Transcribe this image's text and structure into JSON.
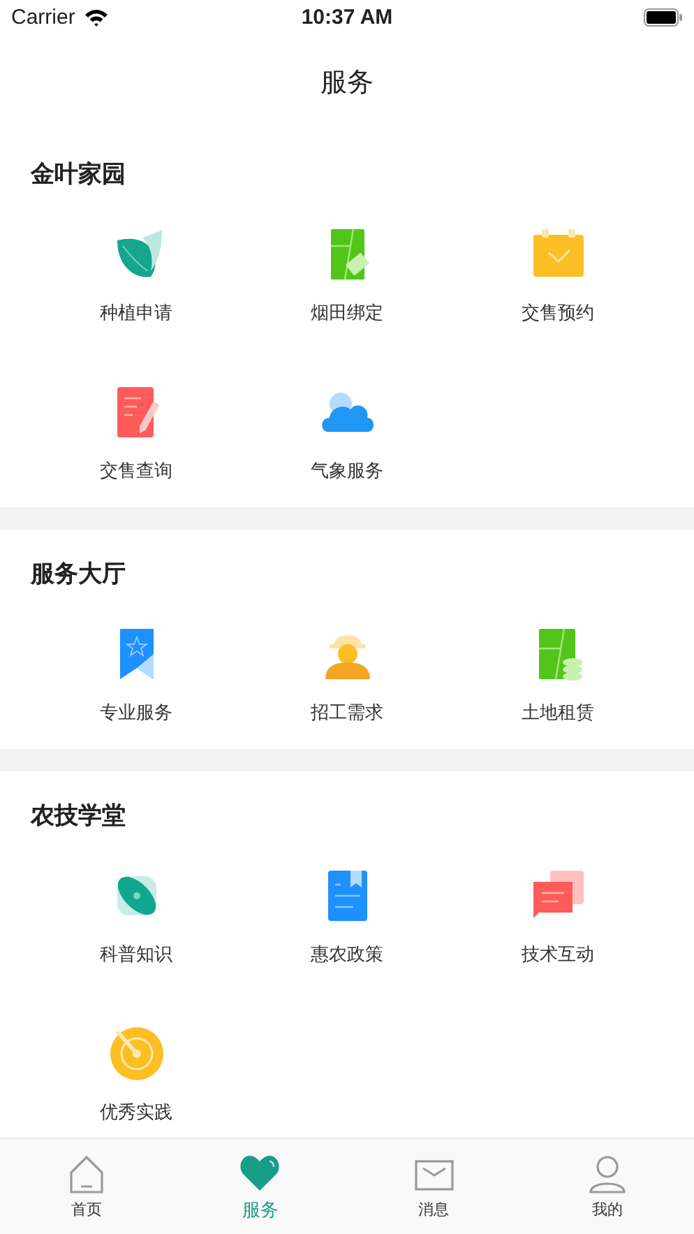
{
  "status_bar": {
    "carrier": "Carrier",
    "time": "10:37 AM"
  },
  "nav_bar": {
    "title": "服务"
  },
  "sections": [
    {
      "title": "金叶家园",
      "items": [
        {
          "label": "种植申请"
        },
        {
          "label": "烟田绑定"
        },
        {
          "label": "交售预约"
        },
        {
          "label": "交售查询"
        },
        {
          "label": "气象服务"
        }
      ]
    },
    {
      "title": "服务大厅",
      "items": [
        {
          "label": "专业服务"
        },
        {
          "label": "招工需求"
        },
        {
          "label": "土地租赁"
        }
      ]
    },
    {
      "title": "农技学堂",
      "items": [
        {
          "label": "科普知识"
        },
        {
          "label": "惠农政策"
        },
        {
          "label": "技术互动"
        },
        {
          "label": "优秀实践"
        }
      ]
    }
  ],
  "tab_bar": [
    {
      "label": "首页",
      "selected": false
    },
    {
      "label": "服务",
      "selected": true
    },
    {
      "label": "消息",
      "selected": false
    },
    {
      "label": "我的",
      "selected": false
    }
  ]
}
